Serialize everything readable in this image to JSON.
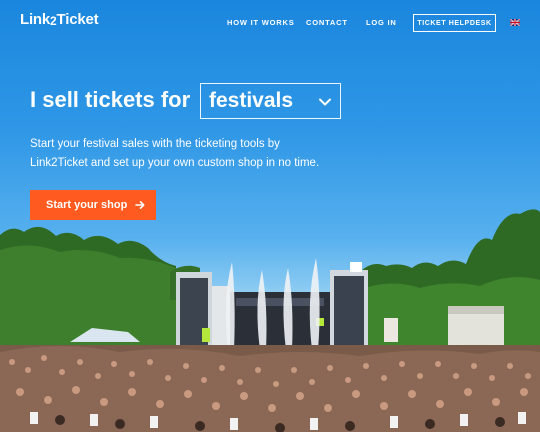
{
  "nav": {
    "logo_text": "Link",
    "logo_two": "2",
    "logo_text2": "Ticket",
    "links": [
      "HOW IT WORKS",
      "CONTACT",
      "LOG IN"
    ],
    "helpdesk_label": "TICKET HELPDESK",
    "language_flag": "uk-flag-icon"
  },
  "hero": {
    "headline_prefix": "I sell tickets for",
    "selected_category": "festivals",
    "subtext": "Start your festival sales with the ticketing tools by Link2Ticket and set up your own custom shop in no time.",
    "cta_label": "Start your shop"
  },
  "colors": {
    "sky_top": "#1a86dd",
    "cta_background": "#ff5a1f",
    "text": "#ffffff"
  }
}
